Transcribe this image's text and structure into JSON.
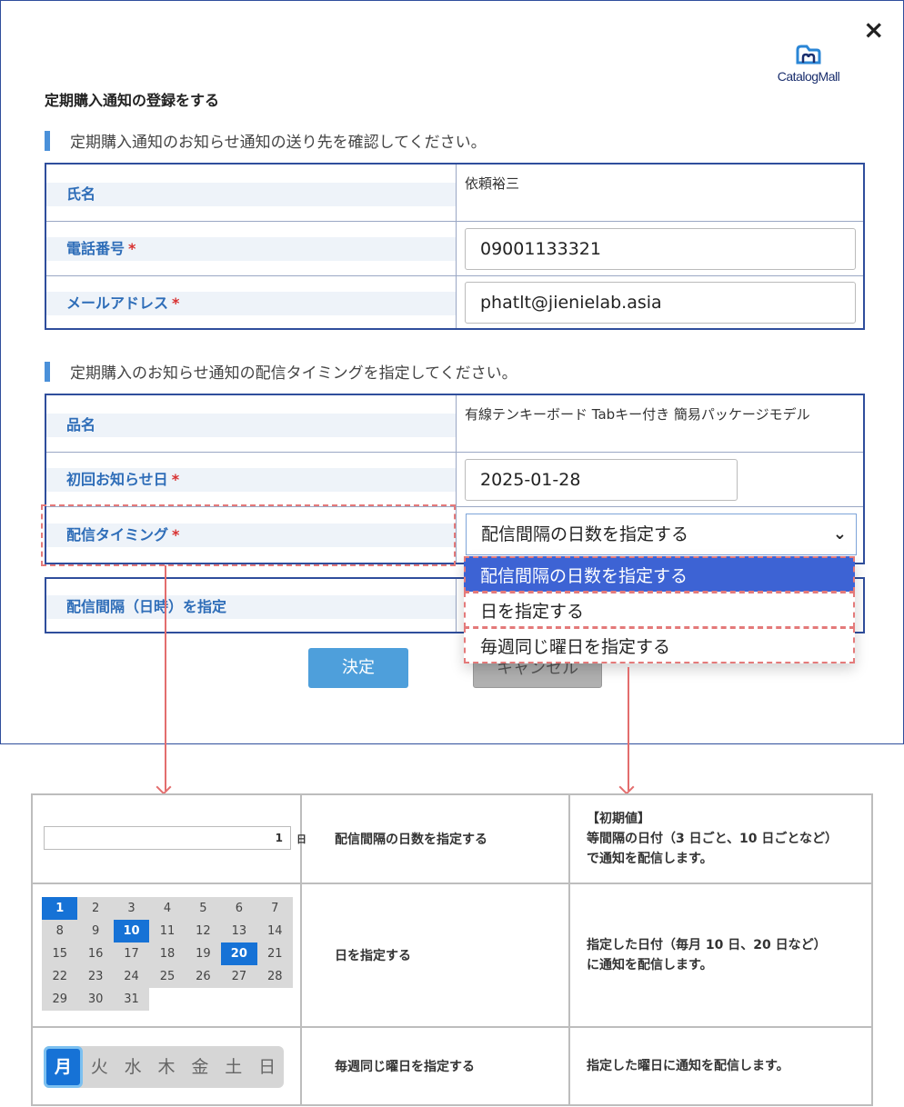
{
  "modal": {
    "close_icon": "×",
    "logo_text": "CatalogMall",
    "title": "定期購入通知の登録をする",
    "section1": "定期購入通知のお知らせ通知の送り先を確認してください。",
    "section2": "定期購入のお知らせ通知の配信タイミングを指定してください。",
    "required_mark": "*",
    "contact": {
      "name_label": "氏名",
      "name_value": "依頼裕三",
      "phone_label": "電話番号",
      "phone_value": "09001133321",
      "email_label": "メールアドレス",
      "email_value": "phatlt@jienielab.asia"
    },
    "timing": {
      "product_label": "品名",
      "product_value": "有線テンキーボード Tabキー付き 簡易パッケージモデル",
      "first_date_label": "初回お知らせ日",
      "first_date_value": "2025-01-28",
      "timing_label": "配信タイミング",
      "timing_selected": "配信間隔の日数を指定する",
      "interval_label": "配信間隔（日時）を指定"
    },
    "dropdown_options": [
      "配信間隔の日数を指定する",
      "日を指定する",
      "毎週同じ曜日を指定する"
    ],
    "ok_button": "決定",
    "cancel_button": "キャンセル"
  },
  "legend": {
    "row1": {
      "number_value": "1",
      "unit": "日",
      "option": "配信間隔の日数を指定する",
      "desc_line1": "【初期値】",
      "desc_line2": "等間隔の日付（3 日ごと、10 日ごとなど）",
      "desc_line3": "で通知を配信します。"
    },
    "row2": {
      "days": [
        "1",
        "2",
        "3",
        "4",
        "5",
        "6",
        "7",
        "8",
        "9",
        "10",
        "11",
        "12",
        "13",
        "14",
        "15",
        "16",
        "17",
        "18",
        "19",
        "20",
        "21",
        "22",
        "23",
        "24",
        "25",
        "26",
        "27",
        "28",
        "29",
        "30",
        "31"
      ],
      "selected_days": [
        "1",
        "10",
        "20"
      ],
      "option": "日を指定する",
      "desc_line1": "指定した日付（毎月 10 日、20 日など）",
      "desc_line2": "に通知を配信します。"
    },
    "row3": {
      "weekdays": [
        "月",
        "火",
        "水",
        "木",
        "金",
        "土",
        "日"
      ],
      "selected_weekday": "月",
      "option": "毎週同じ曜日を指定する",
      "desc_line1": "指定した曜日に通知を配信します。"
    }
  },
  "colors": {
    "accent_blue": "#2f4e9c",
    "label_blue": "#2e6db8",
    "selected_option": "#3d63d4",
    "highlight_dash": "#e47a7a",
    "ok_button": "#4e9fdb"
  }
}
